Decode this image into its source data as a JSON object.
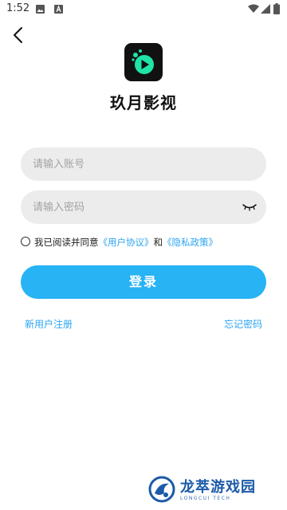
{
  "status_bar": {
    "time": "1:52",
    "icons": [
      "gallery-icon",
      "a-notification-icon",
      "wifi-icon",
      "signal-icon",
      "battery-icon"
    ]
  },
  "header": {
    "back_icon": "chevron-left-icon"
  },
  "app": {
    "name": "玖月影视",
    "logo_icon": "play-icon"
  },
  "form": {
    "account_placeholder": "请输入账号",
    "account_value": "",
    "password_placeholder": "请输入密码",
    "password_value": "",
    "password_toggle_icon": "eye-closed-icon"
  },
  "agreement": {
    "prefix": "我已阅读并同意",
    "user_agreement": "《用户协议》",
    "conjunction": "和",
    "privacy_policy": "《隐私政策》",
    "checked": false
  },
  "actions": {
    "login_label": "登录",
    "register_label": "新用户注册",
    "forgot_label": "忘记密码"
  },
  "watermark": {
    "title": "龙萃游戏园",
    "subtitle": "LONGCUI TECH"
  },
  "colors": {
    "accent": "#27b3f4",
    "link": "#2ba4f1",
    "input_bg": "#ececec",
    "logo_bg": "#111111",
    "logo_play": "#20e3a8"
  }
}
